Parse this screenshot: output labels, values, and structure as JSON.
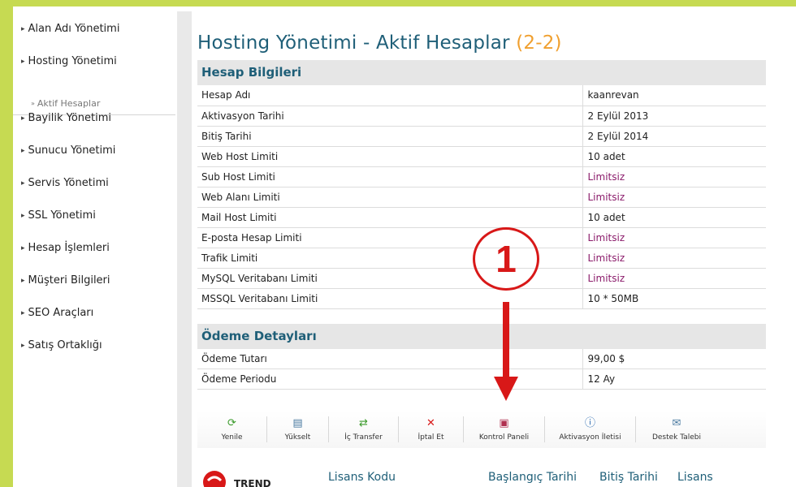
{
  "sidebar": {
    "items": [
      {
        "label": "Alan Adı Yönetimi"
      },
      {
        "label": "Hosting Yönetimi"
      },
      {
        "label": "Bayilik Yönetimi"
      },
      {
        "label": "Sunucu Yönetimi"
      },
      {
        "label": "Servis Yönetimi"
      },
      {
        "label": "SSL Yönetimi"
      },
      {
        "label": "Hesap İşlemleri"
      },
      {
        "label": "Müşteri Bilgileri"
      },
      {
        "label": "SEO Araçları"
      },
      {
        "label": "Satış Ortaklığı"
      }
    ],
    "sub_item": "Aktif Hesaplar"
  },
  "page": {
    "title": "Hosting Yönetimi - Aktif Hesaplar",
    "count": "(2-2)"
  },
  "account_section": {
    "title": "Hesap Bilgileri",
    "rows": [
      {
        "label": "Hesap Adı",
        "value": "kaanrevan"
      },
      {
        "label": "Aktivasyon Tarihi",
        "value": "2 Eylül 2013"
      },
      {
        "label": "Bitiş Tarihi",
        "value": "2 Eylül 2014"
      },
      {
        "label": "Web Host Limiti",
        "value": "10 adet"
      },
      {
        "label": "Sub Host Limiti",
        "value": "Limitsiz"
      },
      {
        "label": "Web Alanı Limiti",
        "value": "Limitsiz"
      },
      {
        "label": "Mail Host Limiti",
        "value": "10 adet"
      },
      {
        "label": "E-posta Hesap Limiti",
        "value": "Limitsiz"
      },
      {
        "label": "Trafik Limiti",
        "value": "Limitsiz"
      },
      {
        "label": "MySQL Veritabanı Limiti",
        "value": "Limitsiz"
      },
      {
        "label": "MSSQL Veritabanı Limiti",
        "value": "10 * 50MB"
      }
    ]
  },
  "payment_section": {
    "title": "Ödeme Detayları",
    "rows": [
      {
        "label": "Ödeme Tutarı",
        "value": "99,00 $"
      },
      {
        "label": "Ödeme Periodu",
        "value": "12 Ay"
      }
    ]
  },
  "toolbar": {
    "buttons": [
      {
        "label": "Yenile",
        "icon": "refresh-icon"
      },
      {
        "label": "Yükselt",
        "icon": "upgrade-icon"
      },
      {
        "label": "İç Transfer",
        "icon": "transfer-icon"
      },
      {
        "label": "İptal Et",
        "icon": "cancel-icon"
      },
      {
        "label": "Kontrol Paneli",
        "icon": "panel-icon"
      },
      {
        "label": "Aktivasyon İletisi",
        "icon": "info-icon"
      },
      {
        "label": "Destek Talebi",
        "icon": "mail-icon"
      }
    ]
  },
  "license": {
    "logo_text": "TREND",
    "col_code": "Lisans Kodu",
    "col_start": "Başlangıç Tarihi",
    "col_end": "Bitiş Tarihi",
    "col_lic": "Lisans"
  },
  "annotation": {
    "number": "1"
  },
  "colors": {
    "accent": "#1f5f78",
    "count": "#f0a030",
    "unlimited": "#8a1a6a",
    "border": "#c6da52",
    "annotation": "#d81818"
  }
}
